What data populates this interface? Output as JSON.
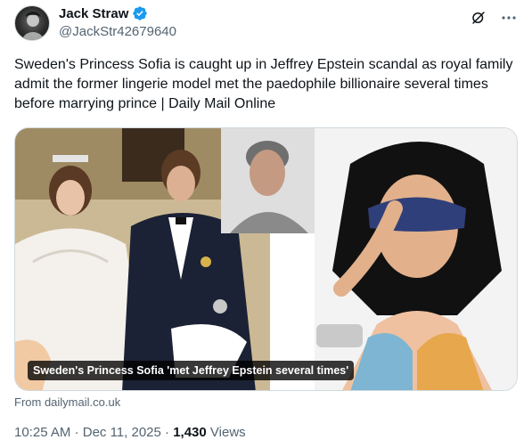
{
  "author": {
    "display_name": "Jack Straw",
    "handle": "@JackStr42679640"
  },
  "tweet": {
    "text": "Sweden's Princess Sofia is caught up in Jeffrey Epstein scandal as royal family admit the former lingerie model met the paedophile billionaire several times before marrying prince | Daily Mail Online"
  },
  "card": {
    "caption": "Sweden's Princess Sofia 'met Jeffrey Epstein several times'",
    "source": "From dailymail.co.uk"
  },
  "meta": {
    "time": "10:25 AM",
    "separator": "·",
    "date": "Dec 11, 2025",
    "views_count": "1,430",
    "views_label": "Views"
  },
  "icons": {
    "verified": "verified-badge-icon",
    "grok": "grok-icon",
    "more": "more-icon"
  },
  "colors": {
    "verified": "#1d9bf0",
    "secondary_text": "#536471",
    "primary_text": "#0f1419"
  }
}
